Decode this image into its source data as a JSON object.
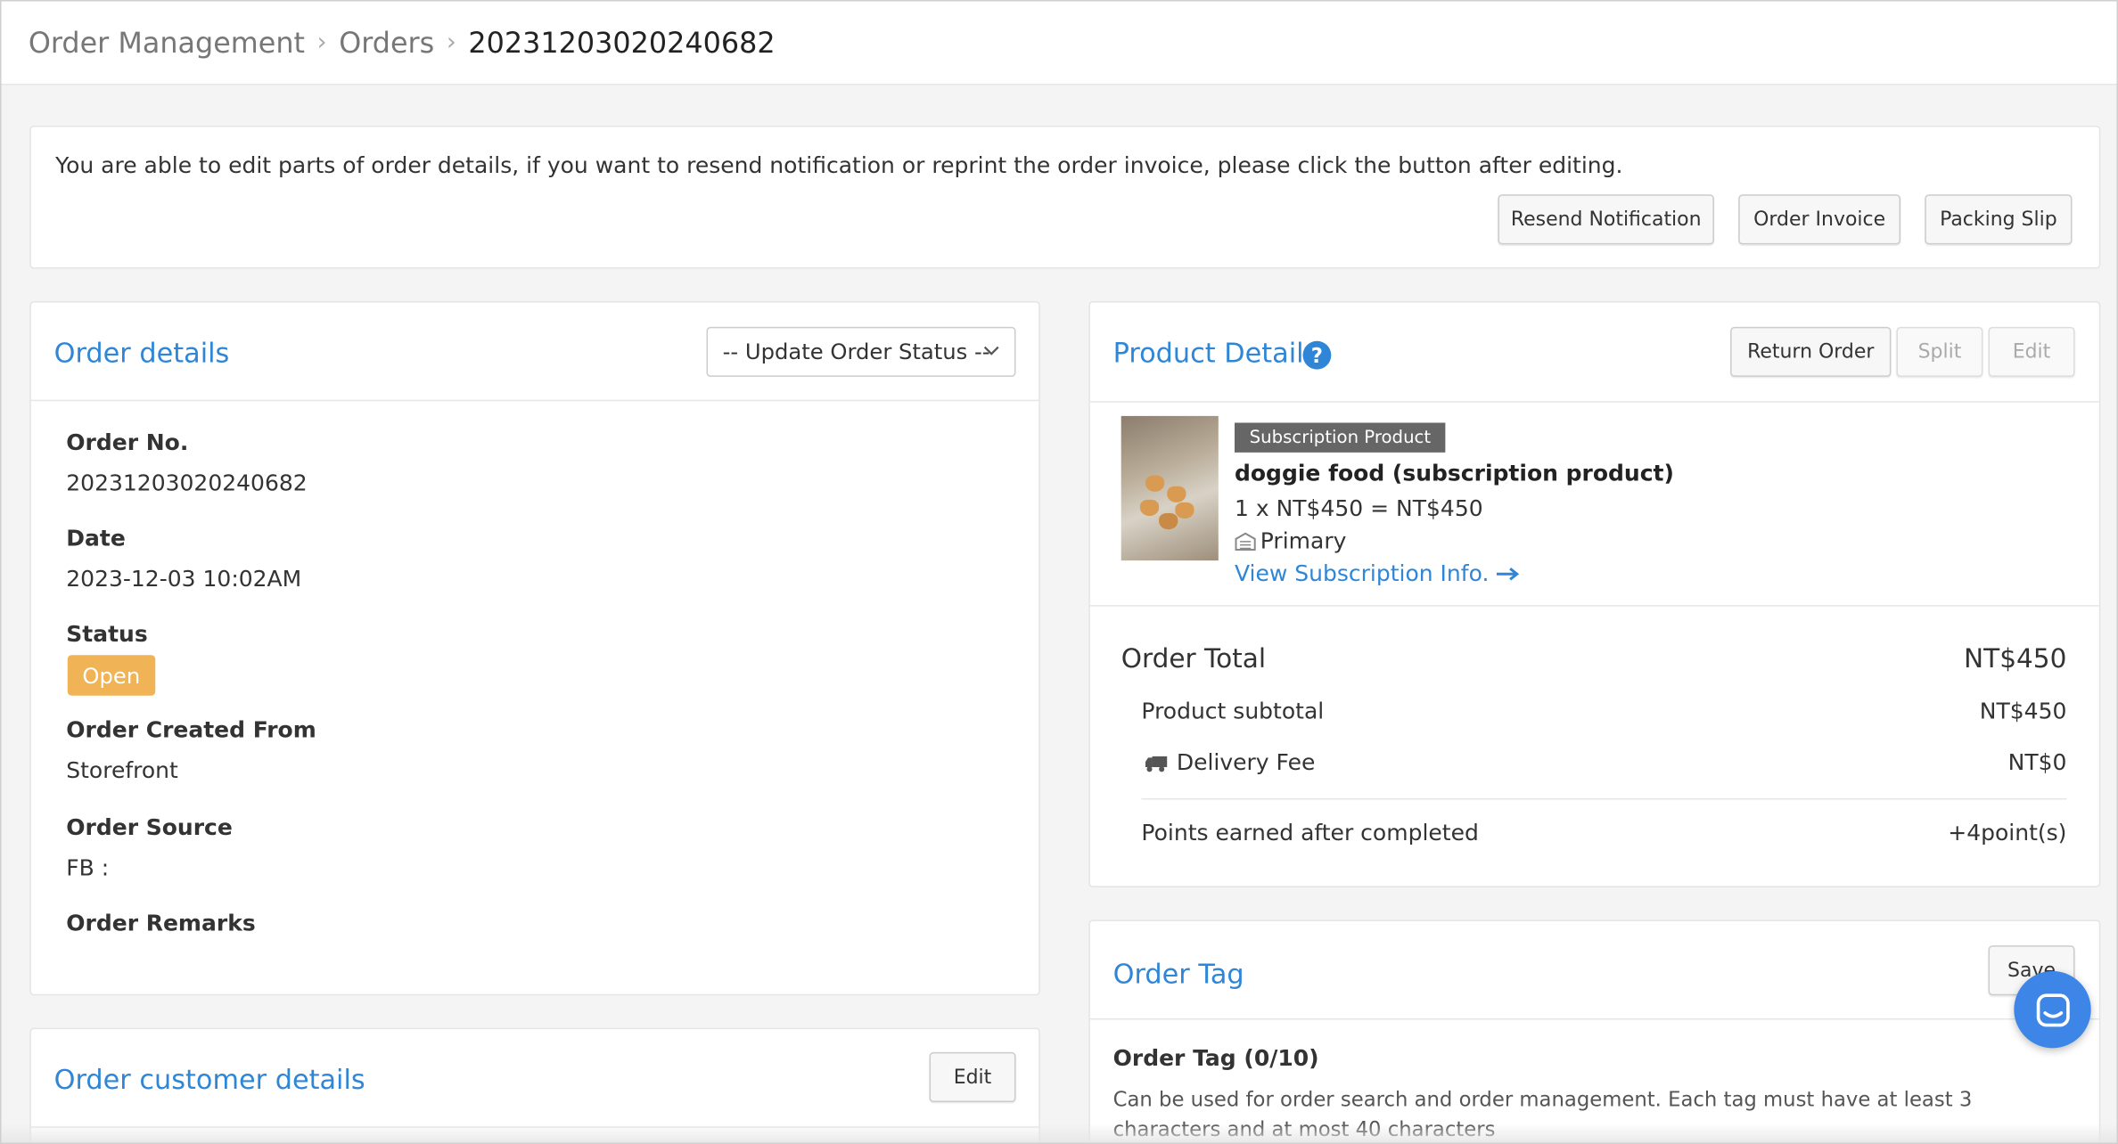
{
  "breadcrumb": {
    "items": [
      "Order Management",
      "Orders"
    ],
    "current": "20231203020240682"
  },
  "notice": {
    "text": "You are able to edit parts of order details, if you want to resend notification or reprint the order invoice, please click the button after editing.",
    "buttons": {
      "resend": "Resend Notification",
      "invoice": "Order Invoice",
      "packing": "Packing Slip"
    }
  },
  "order_details": {
    "title": "Order details",
    "status_select": "-- Update Order Status --",
    "fields": {
      "order_no_label": "Order No.",
      "order_no": "20231203020240682",
      "date_label": "Date",
      "date": "2023-12-03 10:02AM",
      "status_label": "Status",
      "status": "Open",
      "created_from_label": "Order Created From",
      "created_from": "Storefront",
      "source_label": "Order Source",
      "source": "FB :",
      "remarks_label": "Order Remarks"
    }
  },
  "customer_details": {
    "title": "Order customer details",
    "edit": "Edit"
  },
  "product_details": {
    "title": "Product Details",
    "buttons": {
      "return": "Return Order",
      "split": "Split",
      "edit": "Edit"
    },
    "item": {
      "badge": "Subscription Product",
      "name": "doggie food (subscription product)",
      "qty_line": "1 x NT$450 = NT$450",
      "warehouse": "Primary",
      "link": "View Subscription Info."
    },
    "totals": {
      "order_total_label": "Order Total",
      "order_total": "NT$450",
      "subtotal_label": "Product subtotal",
      "subtotal": "NT$450",
      "delivery_label": "Delivery Fee",
      "delivery": "NT$0",
      "points_label": "Points earned after completed",
      "points": "+4point(s)"
    }
  },
  "order_tag": {
    "title": "Order Tag",
    "save": "Save",
    "count_label": "Order Tag (0/10)",
    "help": "Can be used for order search and order management. Each tag must have at least 3 characters and at most 40 characters"
  },
  "colors": {
    "accent": "#2f86d6",
    "status_open": "#f0b356",
    "chat": "#3d86e8"
  },
  "icons": [
    "chevron-right-icon",
    "chevron-down-icon",
    "help-circle-icon",
    "warehouse-icon",
    "arrow-right-icon",
    "truck-icon",
    "chat-icon"
  ]
}
